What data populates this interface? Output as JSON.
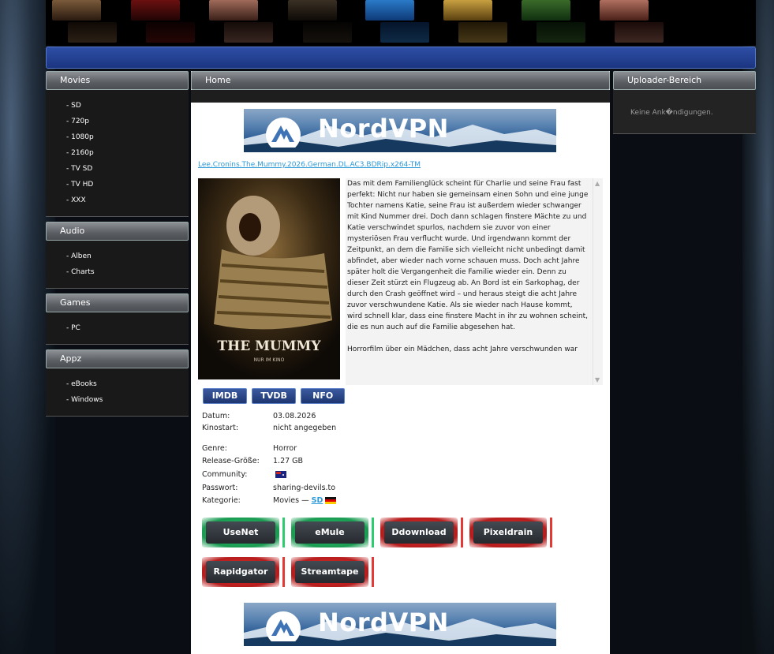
{
  "colors": {
    "accent_link": "#2f9ad8",
    "nav_bar": "#1b3580",
    "download_green": "#2ecc71",
    "download_red": "#e53935"
  },
  "sidebar": {
    "movies": {
      "title": "Movies",
      "items": [
        "- SD",
        "- 720p",
        "- 1080p",
        "- 2160p",
        "- TV SD",
        "- TV HD",
        "- XXX"
      ]
    },
    "audio": {
      "title": "Audio",
      "items": [
        "- Alben",
        "- Charts"
      ]
    },
    "games": {
      "title": "Games",
      "items": [
        "- PC"
      ]
    },
    "appz": {
      "title": "Appz",
      "items": [
        "- eBooks",
        "- Windows"
      ]
    }
  },
  "main": {
    "header": "Home",
    "ad_text": "NordVPN",
    "release_title": "Lee.Cronins.The.Mummy.2026.German.DL.AC3.BDRip.x264-TM",
    "poster_title": "THE MUMMY",
    "poster_tagline": "NUR IM KINO",
    "description_p1": "Das mit dem Familienglück scheint für Charlie und seine Frau fast perfekt: Nicht nur haben sie gemeinsam einen Sohn und eine junge Tochter namens Katie, seine Frau ist außerdem wieder schwanger mit Kind Nummer drei. Doch dann schlagen finstere Mächte zu und Katie verschwindet spurlos, nachdem sie zuvor von einer mysteriösen Frau verflucht wurde. Und irgendwann kommt der Zeitpunkt, an dem die Familie sich vielleicht nicht unbedingt damit abfindet, aber wieder nach vorne schauen muss. Doch acht Jahre später holt die Vergangenheit die Familie wieder ein. Denn zu dieser Zeit stürzt ein Flugzeug ab. An Bord ist ein Sarkophag, der durch den Crash geöffnet wird – und heraus steigt die acht Jahre zuvor verschwundene Katie. Als sie wieder nach Hause kommt, wird schnell klar, dass eine finstere Macht in ihr zu wohnen scheint, die es nun auch auf die Familie abgesehen hat.",
    "description_p2": "Horrorfilm über ein Mädchen, dass acht Jahre verschwunden war",
    "db_buttons": [
      "IMDB",
      "TVDB",
      "NFO"
    ],
    "info": {
      "datum_label": "Datum:",
      "datum_value": "03.08.2026",
      "kinostart_label": "Kinostart:",
      "kinostart_value": "nicht angegeben",
      "genre_label": "Genre:",
      "genre_value": "Horror",
      "size_label": "Release-Größe:",
      "size_value": "1.27 GB",
      "community_label": "Community:",
      "passwort_label": "Passwort:",
      "passwort_value": "sharing-devils.to",
      "kategorie_label": "Kategorie:",
      "kategorie_value": "Movies —",
      "kategorie_sub": "SD"
    },
    "downloads": [
      {
        "label": "UseNet",
        "color": "green"
      },
      {
        "label": "eMule",
        "color": "green"
      },
      {
        "label": "Ddownload",
        "color": "red"
      },
      {
        "label": "Pixeldrain",
        "color": "red"
      },
      {
        "label": "Rapidgator",
        "color": "red"
      },
      {
        "label": "Streamtape",
        "color": "red"
      }
    ]
  },
  "right": {
    "title": "Uploader-Bereich",
    "message": "Keine Ank�ndigungen."
  }
}
